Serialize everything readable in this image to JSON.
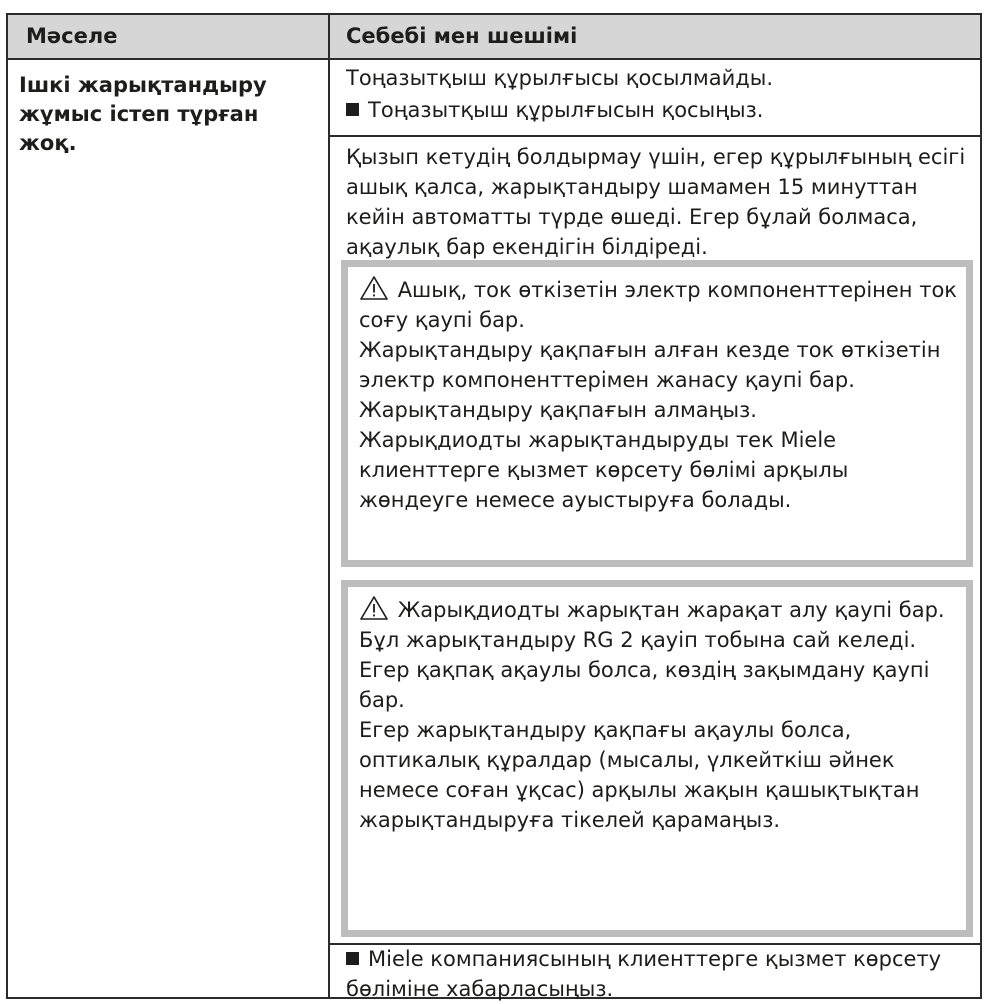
{
  "header": {
    "col1": "Мәселе",
    "col2": "Себебі мен шешімі"
  },
  "problem": "Ішкі жарықтандыру жұмыс істеп тұрған жоқ.",
  "cause1": {
    "text": "Тоңазытқыш құрылғысы қосылмайды.",
    "action": "Тоңазытқыш құрылғысын қосыңыз."
  },
  "cause2": {
    "text": "Қызып кетудің болдырмау үшін, егер құрылғының есігі ашық қалса, жарықтандыру шамамен 15 минуттан кейін автоматты түрде өшеді. Егер бұлай болмаса, ақаулық бар екендігін білдіреді."
  },
  "warning1": {
    "icon": "warning-triangle-icon",
    "title": "Ашық, ток өткізетін электр компоненттерінен ток соғу қаупі бар.",
    "p1": "Жарықтандыру қақпағын алған кезде ток өткізетін электр компоненттерімен жанасу қаупі бар.",
    "p2": "Жарықтандыру қақпағын алмаңыз.",
    "p3": "Жарықдиодты жарықтандыруды тек Miele клиенттерге қызмет көрсету бөлімі арқылы жөндеуге немесе ауыстыруға болады."
  },
  "warning2": {
    "icon": "warning-triangle-icon",
    "title": "Жарықдиодты жарықтан жарақат алу қаупі бар.",
    "p1": "Бұл жарықтандыру RG 2 қауіп тобына сай келеді.",
    "p2": "Егер қақпақ ақаулы болса, көздің зақымдану қаупі бар.",
    "p3": "Егер жарықтандыру қақпағы ақаулы болса, оптикалық құралдар (мысалы, үлкейткіш әйнек немесе соған ұқсас) арқылы жақын қашықтықтан жарықтандыруға тікелей қарамаңыз."
  },
  "final_action": "Miele компаниясының клиенттерге қызмет көрсету бөліміне хабарласыңыз."
}
